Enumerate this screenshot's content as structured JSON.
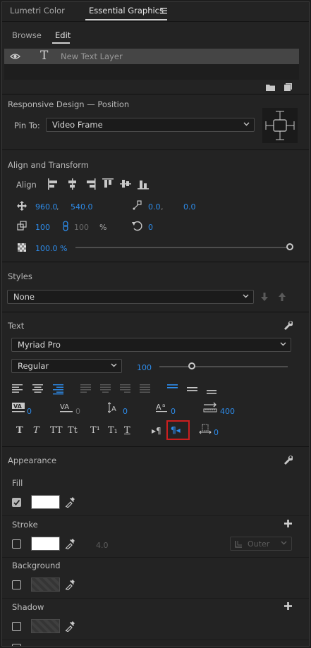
{
  "header": {
    "tabs": [
      {
        "label": "Lumetri Color"
      },
      {
        "label": "Essential Graphics"
      }
    ],
    "menu_icon": "hamburger-menu-icon"
  },
  "subtabs": [
    {
      "label": "Browse"
    },
    {
      "label": "Edit"
    }
  ],
  "layer": {
    "name": "New Text Layer"
  },
  "responsive": {
    "title": "Responsive Design — Position",
    "pin_label": "Pin To:",
    "pin_value": "Video Frame"
  },
  "align_transform": {
    "title": "Align and Transform",
    "align_label": "Align",
    "position_x": "960.0",
    "position_y": "540.0",
    "anchor_x": "0.0",
    "anchor_y": "0.0",
    "scale": "100",
    "scale_linked": "100",
    "percent": "%",
    "rotation": "0",
    "opacity": "100.0 %",
    "opacity_level": 1.0,
    "comma": ","
  },
  "styles": {
    "title": "Styles",
    "value": "None"
  },
  "text": {
    "title": "Text",
    "font": "Myriad Pro",
    "weight": "Regular",
    "size": "100",
    "size_level": 0.25,
    "kerning": "0",
    "tracking": "0",
    "leading": "0",
    "baseline": "0",
    "tab_width": "400",
    "tsume": "0",
    "style_buttons": [
      "T",
      "T",
      "TT",
      "Tt",
      "T¹",
      "T₁",
      "T"
    ],
    "direction_ltr": "▸¶",
    "direction_rtl": "¶◂"
  },
  "appearance": {
    "title": "Appearance",
    "fill_label": "Fill",
    "stroke_label": "Stroke",
    "stroke_width": "4.0",
    "stroke_type": "Outer",
    "background_label": "Background",
    "shadow_label": "Shadow",
    "fill_color": "#ffffff",
    "stroke_color": "#ffffff"
  },
  "colors": {
    "accent": "#2d8ceb",
    "highlight": "#cc1f1f"
  }
}
